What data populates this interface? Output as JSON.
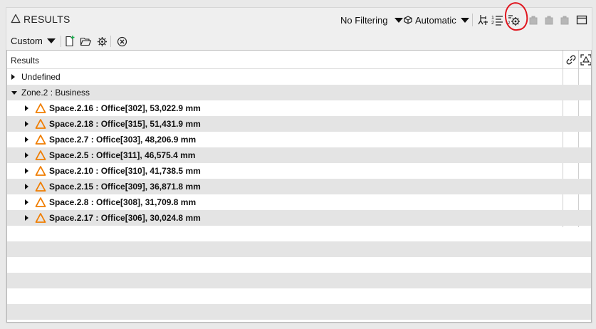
{
  "window": {
    "title": "RESULTS"
  },
  "toolbar": {
    "filter_label": "No Filtering",
    "mode_label": "Automatic"
  },
  "toolbar2": {
    "preset_label": "Custom"
  },
  "tree": {
    "header": "Results",
    "rows": [
      {
        "label": "Undefined",
        "level": 0,
        "expanded": false,
        "bold": false,
        "icon": false
      },
      {
        "label": "Zone.2 : Business",
        "level": 0,
        "expanded": true,
        "bold": false,
        "icon": false
      },
      {
        "label": "Space.2.16 : Office[302], 53,022.9 mm",
        "level": 1,
        "expanded": false,
        "bold": true,
        "icon": true
      },
      {
        "label": "Space.2.18 : Office[315], 51,431.9 mm",
        "level": 1,
        "expanded": false,
        "bold": true,
        "icon": true
      },
      {
        "label": "Space.2.7 : Office[303], 48,206.9 mm",
        "level": 1,
        "expanded": false,
        "bold": true,
        "icon": true
      },
      {
        "label": "Space.2.5 : Office[311], 46,575.4 mm",
        "level": 1,
        "expanded": false,
        "bold": true,
        "icon": true
      },
      {
        "label": "Space.2.10 : Office[310], 41,738.5 mm",
        "level": 1,
        "expanded": false,
        "bold": true,
        "icon": true
      },
      {
        "label": "Space.2.15 : Office[309], 36,871.8 mm",
        "level": 1,
        "expanded": false,
        "bold": true,
        "icon": true
      },
      {
        "label": "Space.2.8 : Office[308], 31,709.8 mm",
        "level": 1,
        "expanded": false,
        "bold": true,
        "icon": true
      },
      {
        "label": "Space.2.17 : Office[306], 30,024.8 mm",
        "level": 1,
        "expanded": false,
        "bold": true,
        "icon": true
      }
    ]
  },
  "icons": {
    "title": "triangle-outline-icon",
    "space": "orange-triangle-icon",
    "accent": "#f07d00",
    "highlight": "#e0161f"
  }
}
